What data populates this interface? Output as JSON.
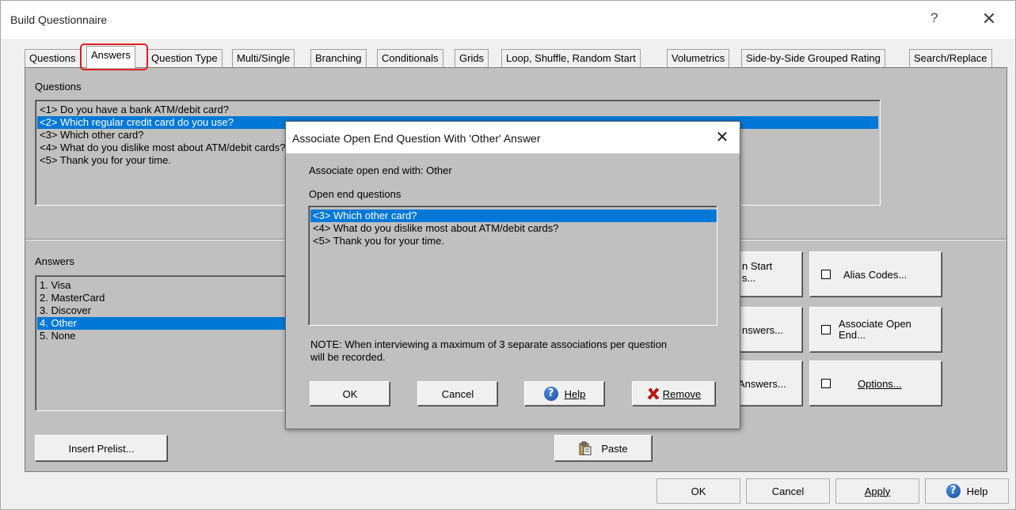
{
  "window": {
    "title": "Build Questionnaire",
    "help_glyph": "?",
    "close_glyph": "✕"
  },
  "tabs": [
    {
      "label": "Questions"
    },
    {
      "label": "Answers",
      "active": true
    },
    {
      "label": "Question Type"
    },
    {
      "label": "Multi/Single"
    },
    {
      "label": "Branching"
    },
    {
      "label": "Conditionals"
    },
    {
      "label": "Grids"
    },
    {
      "label": "Loop, Shuffle, Random Start"
    },
    {
      "label": "Volumetrics"
    },
    {
      "label": "Side-by-Side Grouped Rating"
    },
    {
      "label": "Search/Replace"
    }
  ],
  "questions": {
    "label": "Questions",
    "items": [
      "<1>  Do you have a bank ATM/debit card?",
      "<2>  Which regular credit card do you use?",
      "<3>  Which other card?",
      "<4>  What do you dislike most about ATM/debit cards?",
      "<5>  Thank you for your time."
    ],
    "selected_index": 1
  },
  "answers": {
    "label": "Answers",
    "items": [
      "1. Visa",
      "2. MasterCard",
      "3. Discover",
      "4. Other",
      "5. None"
    ],
    "selected_index": 3
  },
  "buttons": {
    "insert_prelist": "Insert Prelist...",
    "paste": "Paste",
    "partial_random_start": "n Start",
    "partial_random_start_2": "s...",
    "partial_answers_1": "nswers...",
    "partial_answers_2": "Answers...",
    "alias_codes": "Alias Codes...",
    "associate_open_end_1": "Associate Open",
    "associate_open_end_2": "End...",
    "options": "Options..."
  },
  "footer": {
    "ok": "OK",
    "cancel": "Cancel",
    "apply": "Apply",
    "help": "Help"
  },
  "dialog": {
    "title": "Associate Open End Question With 'Other' Answer",
    "close_glyph": "✕",
    "associate_text": "Associate open end with: Other",
    "list_label": "Open end questions",
    "items": [
      "<3>  Which other card?",
      "<4>  What do you dislike most about ATM/debit cards?",
      "<5>  Thank you for your time."
    ],
    "selected_index": 0,
    "note_line1": "NOTE: When interviewing a maximum of 3 separate associations per question",
    "note_line2": "will be recorded.",
    "ok": "OK",
    "cancel": "Cancel",
    "help": "Help",
    "remove": "Remove"
  },
  "colors": {
    "selection": "#0078d7",
    "panel": "#c0c0c0",
    "highlight_ring": "#e02020"
  }
}
